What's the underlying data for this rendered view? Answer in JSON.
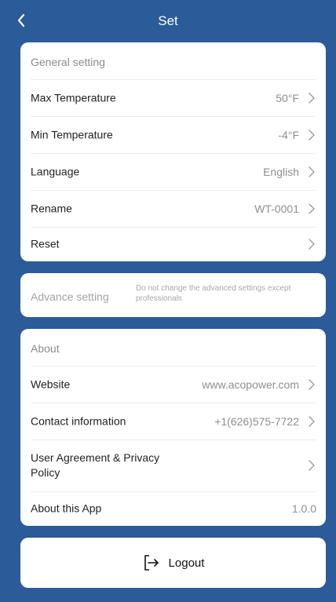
{
  "header": {
    "title": "Set"
  },
  "general": {
    "title": "General setting",
    "rows": [
      {
        "label": "Max Temperature",
        "value": "50°F"
      },
      {
        "label": "Min Temperature",
        "value": "-4°F"
      },
      {
        "label": "Language",
        "value": "English"
      },
      {
        "label": "Rename",
        "value": "WT-0001"
      },
      {
        "label": "Reset",
        "value": ""
      }
    ]
  },
  "advanced": {
    "label": "Advance setting",
    "note": "Do not change the advanced settings except professionals"
  },
  "about": {
    "title": "About",
    "rows": [
      {
        "label": "Website",
        "value": "www.acopower.com"
      },
      {
        "label": "Contact information",
        "value": "+1(626)575-7722"
      },
      {
        "label": "User Agreement & Privacy Policy",
        "value": ""
      },
      {
        "label": "About this App",
        "value": "1.0.0"
      }
    ]
  },
  "logout": {
    "label": "Logout"
  },
  "colors": {
    "background": "#2b5b98",
    "card": "#ffffff"
  },
  "icons": {
    "back": "chevron-left-icon",
    "row": "chevron-right-icon",
    "logout": "logout-icon"
  }
}
